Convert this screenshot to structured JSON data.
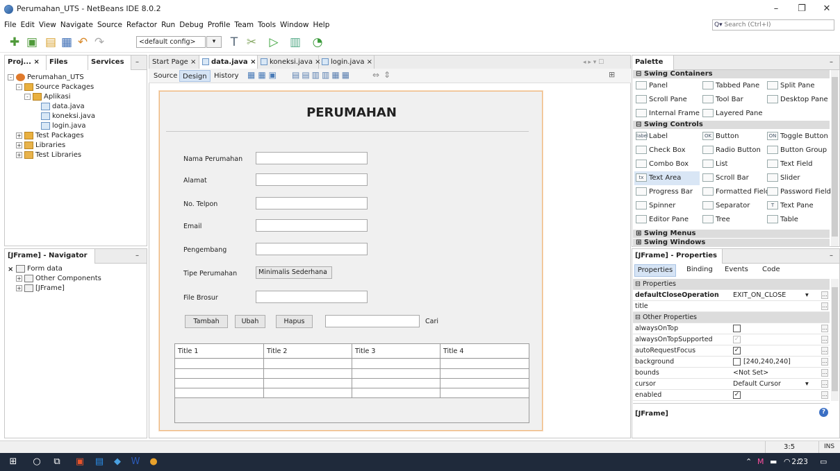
{
  "window": {
    "title": "Perumahan_UTS - NetBeans IDE 8.0.2"
  },
  "menu": [
    "File",
    "Edit",
    "View",
    "Navigate",
    "Source",
    "Refactor",
    "Run",
    "Debug",
    "Profile",
    "Team",
    "Tools",
    "Window",
    "Help"
  ],
  "search": {
    "placeholder": "Search (Ctrl+I)"
  },
  "toolbar": {
    "config": "<default config>"
  },
  "projects_panel": {
    "tabs": [
      "Proj...",
      "Files",
      "Services"
    ],
    "tree": [
      {
        "label": "Perumahan_UTS",
        "depth": 0,
        "icon": "proj",
        "toggle": "-"
      },
      {
        "label": "Source Packages",
        "depth": 1,
        "icon": "pkg",
        "toggle": "-"
      },
      {
        "label": "Aplikasi",
        "depth": 2,
        "icon": "pkg",
        "toggle": "-"
      },
      {
        "label": "data.java",
        "depth": 3,
        "icon": "java",
        "toggle": ""
      },
      {
        "label": "koneksi.java",
        "depth": 3,
        "icon": "java",
        "toggle": ""
      },
      {
        "label": "login.java",
        "depth": 3,
        "icon": "java",
        "toggle": ""
      },
      {
        "label": "Test Packages",
        "depth": 1,
        "icon": "pkg",
        "toggle": "+"
      },
      {
        "label": "Libraries",
        "depth": 1,
        "icon": "lib",
        "toggle": "+"
      },
      {
        "label": "Test Libraries",
        "depth": 1,
        "icon": "lib",
        "toggle": "+"
      }
    ]
  },
  "navigator": {
    "title": "[JFrame] - Navigator",
    "tree": [
      {
        "label": "Form data",
        "depth": 0,
        "toggle": ""
      },
      {
        "label": "Other Components",
        "depth": 1,
        "toggle": "+"
      },
      {
        "label": "[JFrame]",
        "depth": 1,
        "toggle": "+"
      }
    ]
  },
  "editor": {
    "tabs": [
      {
        "label": "Start Page",
        "active": false
      },
      {
        "label": "data.java",
        "active": true
      },
      {
        "label": "koneksi.java",
        "active": false
      },
      {
        "label": "login.java",
        "active": false
      }
    ],
    "views": [
      "Source",
      "Design",
      "History"
    ],
    "active_view": "Design"
  },
  "form": {
    "title": "PERUMAHAN",
    "fields": [
      {
        "label": "Nama Perumahan",
        "value": ""
      },
      {
        "label": "Alamat",
        "value": ""
      },
      {
        "label": "No. Telpon",
        "value": ""
      },
      {
        "label": "Email",
        "value": ""
      },
      {
        "label": "Pengembang",
        "value": ""
      }
    ],
    "type_label": "Tipe Perumahan",
    "type_value": "Minimalis Sederhana",
    "brosur_label": "File Brosur",
    "buttons": {
      "add": "Tambah",
      "edit": "Ubah",
      "delete": "Hapus"
    },
    "search_label": "Cari",
    "table": {
      "columns": [
        "Title 1",
        "Title 2",
        "Title 3",
        "Title 4"
      ],
      "rows": 4
    }
  },
  "palette": {
    "title": "Palette",
    "categories": {
      "containers": "Swing Containers",
      "controls": "Swing Controls",
      "menus": "Swing Menus",
      "windows": "Swing Windows"
    },
    "containers": [
      {
        "label": "Panel",
        "icon": ""
      },
      {
        "label": "Tabbed Pane",
        "icon": ""
      },
      {
        "label": "Split Pane",
        "icon": ""
      },
      {
        "label": "Scroll Pane",
        "icon": ""
      },
      {
        "label": "Tool Bar",
        "icon": ""
      },
      {
        "label": "Desktop Pane",
        "icon": ""
      },
      {
        "label": "Internal Frame",
        "icon": ""
      },
      {
        "label": "Layered Pane",
        "icon": ""
      }
    ],
    "controls": [
      {
        "label": "Label",
        "icon": "label"
      },
      {
        "label": "Button",
        "icon": "OK"
      },
      {
        "label": "Toggle Button",
        "icon": "ON"
      },
      {
        "label": "Check Box",
        "icon": ""
      },
      {
        "label": "Radio Button",
        "icon": ""
      },
      {
        "label": "Button Group",
        "icon": ""
      },
      {
        "label": "Combo Box",
        "icon": ""
      },
      {
        "label": "List",
        "icon": ""
      },
      {
        "label": "Text Field",
        "icon": ""
      },
      {
        "label": "Text Area",
        "icon": "tx"
      },
      {
        "label": "Scroll Bar",
        "icon": ""
      },
      {
        "label": "Slider",
        "icon": ""
      },
      {
        "label": "Progress Bar",
        "icon": ""
      },
      {
        "label": "Formatted Field",
        "icon": ""
      },
      {
        "label": "Password Field",
        "icon": ""
      },
      {
        "label": "Spinner",
        "icon": ""
      },
      {
        "label": "Separator",
        "icon": ""
      },
      {
        "label": "Text Pane",
        "icon": "T"
      },
      {
        "label": "Editor Pane",
        "icon": ""
      },
      {
        "label": "Tree",
        "icon": ""
      },
      {
        "label": "Table",
        "icon": ""
      }
    ]
  },
  "properties": {
    "title": "[JFrame] - Properties",
    "tabs": [
      "Properties",
      "Binding",
      "Events",
      "Code"
    ],
    "cat1": "Properties",
    "cat2": "Other Properties",
    "rows1": [
      {
        "name": "defaultCloseOperation",
        "value": "EXIT_ON_CLOSE",
        "bold": true
      },
      {
        "name": "title",
        "value": ""
      }
    ],
    "rows2": [
      {
        "name": "alwaysOnTop",
        "value": "",
        "check": "off"
      },
      {
        "name": "alwaysOnTopSupported",
        "value": "",
        "check": "dis"
      },
      {
        "name": "autoRequestFocus",
        "value": "",
        "check": "on"
      },
      {
        "name": "background",
        "value": "[240,240,240]",
        "check": "box"
      },
      {
        "name": "bounds",
        "value": "<Not Set>",
        "check": ""
      },
      {
        "name": "cursor",
        "value": "Default Cursor",
        "check": ""
      },
      {
        "name": "enabled",
        "value": "",
        "check": "on"
      }
    ],
    "footer": "[JFrame]"
  },
  "status": {
    "position": "3:5",
    "mode": "INS"
  },
  "taskbar": {
    "time": "2:23"
  }
}
